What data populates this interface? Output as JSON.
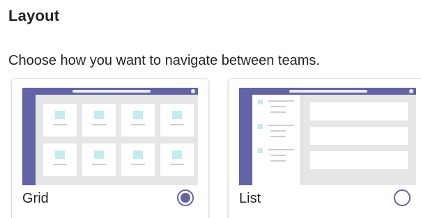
{
  "layout_section": {
    "title": "Layout",
    "description": "Choose how you want to navigate between teams."
  },
  "options": [
    {
      "label": "Grid",
      "selected": true
    },
    {
      "label": "List",
      "selected": false
    }
  ],
  "colors": {
    "accent": "#6264a7",
    "tile_highlight": "#c2ecf0",
    "thumbnail_background": "#e6e6e6"
  }
}
